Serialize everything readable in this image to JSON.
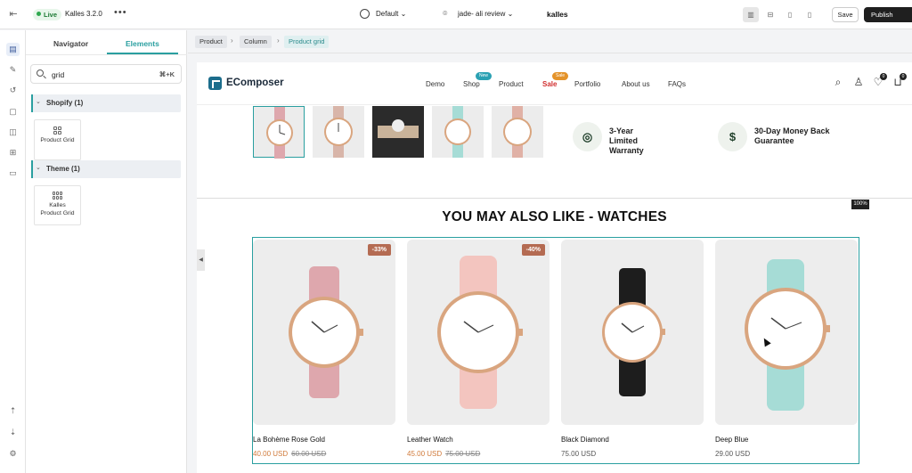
{
  "topbar": {
    "live_label": "Live",
    "app_name": "Kalles 3.2.0",
    "more": "•••",
    "page_select": "Default",
    "theme_select": "jade- ali review",
    "store_name": "kalles",
    "save_label": "Save",
    "publish_label": "Publish"
  },
  "panel": {
    "tab_navigator": "Navigator",
    "tab_elements": "Elements",
    "search_value": "grid",
    "search_shortcut": "⌘+K",
    "group_shopify": "Shopify (1)",
    "group_theme": "Theme (1)",
    "el_product_grid": "Product Grid",
    "el_kalles_grid_1": "Kalles",
    "el_kalles_grid_2": "Product Grid"
  },
  "breadcrumb": [
    "Product",
    "Column",
    "Product grid"
  ],
  "site": {
    "logo": "EComposer",
    "menu": [
      "Demo",
      "Shop",
      "Product",
      "Sale",
      "Portfolio",
      "About us",
      "FAQs"
    ],
    "badge_new": "New",
    "badge_sale": "Sale",
    "wishlist_count": "0",
    "cart_count": "0",
    "feature_1": "3-Year Limited Warranty",
    "feature_2": "30-Day Money Back Guarantee",
    "zoom": "100%",
    "section_title": "YOU MAY ALSO LIKE - WATCHES"
  },
  "products": [
    {
      "name": "La Bohème Rose Gold",
      "price": "40.00 USD",
      "compare": "60.00 USD",
      "discount": "-33%",
      "strap": "#dea7ad"
    },
    {
      "name": "Leather Watch",
      "price": "45.00 USD",
      "compare": "75.00 USD",
      "discount": "-40%",
      "strap": "#f3c5bf"
    },
    {
      "name": "Black Diamond",
      "price": "75.00 USD",
      "compare": "",
      "discount": "",
      "strap": "#1d1d1d"
    },
    {
      "name": "Deep Blue",
      "price": "29.00 USD",
      "compare": "",
      "discount": "",
      "strap": "#a6dcd6"
    }
  ],
  "colors": {
    "accent": "#2a9fa0",
    "discount_badge": "#b46b52",
    "sale_price": "#d07a3a"
  }
}
